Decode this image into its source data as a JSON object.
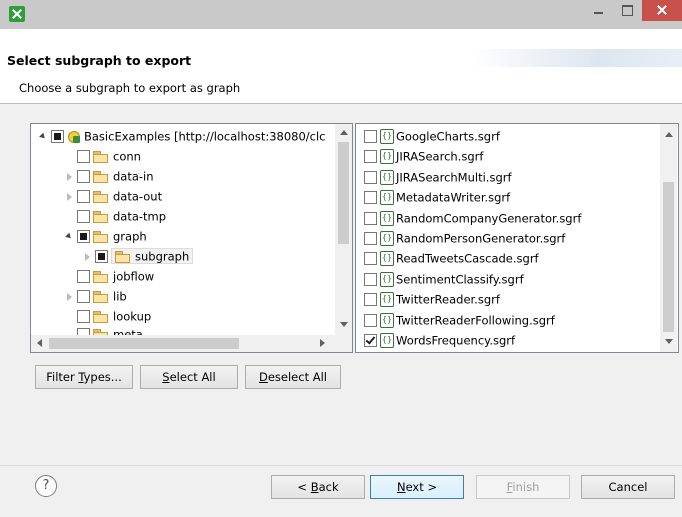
{
  "window": {
    "title": ""
  },
  "header": {
    "title": "Select subgraph to export",
    "description": "Choose a subgraph to export as graph"
  },
  "tree": {
    "root": "BasicExamples [http://localhost:38080/clc",
    "items": [
      "conn",
      "data-in",
      "data-out",
      "data-tmp",
      "graph",
      "subgraph",
      "jobflow",
      "lib",
      "lookup",
      "meta"
    ]
  },
  "files": {
    "items": [
      "GoogleCharts.sgrf",
      "JIRASearch.sgrf",
      "JIRASearchMulti.sgrf",
      "MetadataWriter.sgrf",
      "RandomCompanyGenerator.sgrf",
      "RandomPersonGenerator.sgrf",
      "ReadTweetsCascade.sgrf",
      "SentimentClassify.sgrf",
      "TwitterReader.sgrf",
      "TwitterReaderFollowing.sgrf",
      "WordsFrequency.sgrf"
    ],
    "checked": [
      false,
      false,
      false,
      false,
      false,
      false,
      false,
      false,
      false,
      false,
      true
    ]
  },
  "buttons": {
    "filter_pre": "Filter ",
    "filter_u": "T",
    "filter_post": "ypes...",
    "selectall_u": "S",
    "selectall_post": "elect All",
    "deselectall_u": "D",
    "deselectall_post": "eselect All",
    "back_pre": "< ",
    "back_u": "B",
    "back_post": "ack",
    "next_u": "N",
    "next_post": "ext >",
    "finish_u": "F",
    "finish_post": "inish",
    "cancel": "Cancel",
    "help": "?"
  },
  "colors": {
    "close_button": "#c7504a",
    "titlebar": "#c9c9c9",
    "default_button_border": "#3c7fb1"
  },
  "icons": {
    "app": "app-icon",
    "help": "help-icon",
    "folder": "folder-icon",
    "subgraph_file": "sgrf-file-icon"
  }
}
